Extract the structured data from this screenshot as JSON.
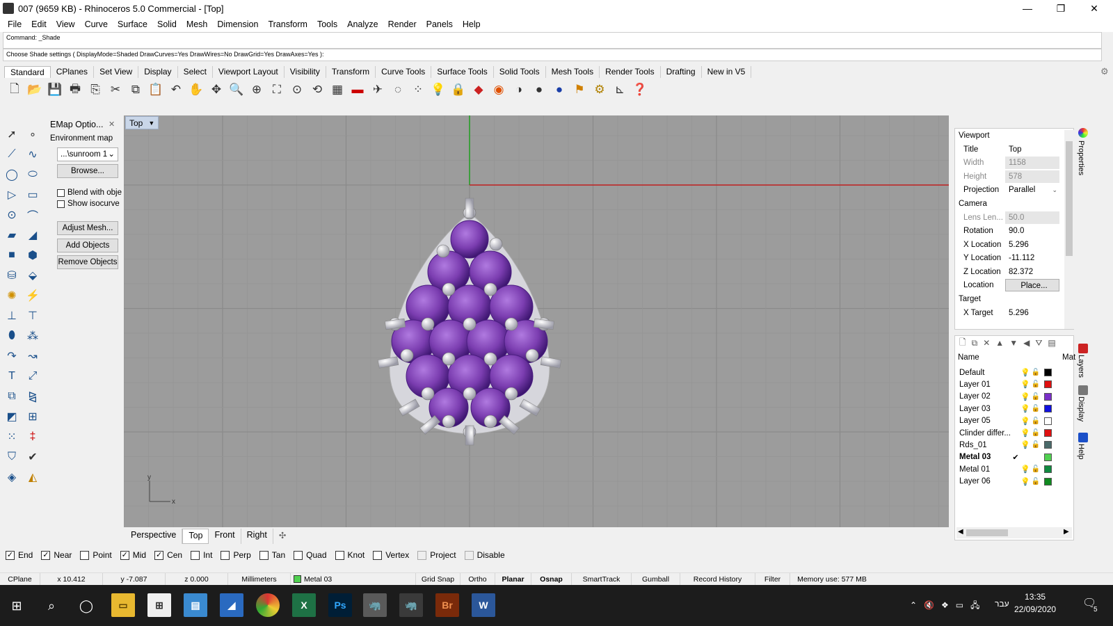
{
  "window": {
    "title": "007 (9659 KB) - Rhinoceros 5.0 Commercial - [Top]"
  },
  "menu": [
    "File",
    "Edit",
    "View",
    "Curve",
    "Surface",
    "Solid",
    "Mesh",
    "Dimension",
    "Transform",
    "Tools",
    "Analyze",
    "Render",
    "Panels",
    "Help"
  ],
  "command": {
    "history": "Command: _Shade",
    "prompt": "Choose Shade settings ( DisplayMode=Shaded  DrawCurves=Yes  DrawWires=No  DrawGrid=Yes  DrawAxes=Yes ):"
  },
  "toolbar_tabs": [
    "Standard",
    "CPlanes",
    "Set View",
    "Display",
    "Select",
    "Viewport Layout",
    "Visibility",
    "Transform",
    "Curve Tools",
    "Surface Tools",
    "Solid Tools",
    "Mesh Tools",
    "Render Tools",
    "Drafting",
    "New in V5"
  ],
  "emap": {
    "title": "EMap Optio...",
    "env_label": "Environment map",
    "env_value": "...\\sunroom 1",
    "browse": "Browse...",
    "blend": "Blend with obje",
    "isocurve": "Show isocurve",
    "adjust": "Adjust Mesh...",
    "add": "Add Objects",
    "remove": "Remove Objects"
  },
  "viewport": {
    "name": "Top",
    "axis_x": "x",
    "axis_y": "y"
  },
  "viewport_tabs": [
    "Perspective",
    "Top",
    "Front",
    "Right"
  ],
  "properties": {
    "section_viewport": "Viewport",
    "title_k": "Title",
    "title_v": "Top",
    "width_k": "Width",
    "width_v": "1158",
    "height_k": "Height",
    "height_v": "578",
    "projection_k": "Projection",
    "projection_v": "Parallel",
    "section_camera": "Camera",
    "lens_k": "Lens Len...",
    "lens_v": "50.0",
    "rotation_k": "Rotation",
    "rotation_v": "90.0",
    "xloc_k": "X Location",
    "xloc_v": "5.296",
    "yloc_k": "Y Location",
    "yloc_v": "-11.112",
    "zloc_k": "Z Location",
    "zloc_v": "82.372",
    "location_k": "Location",
    "location_v": "Place...",
    "section_target": "Target",
    "xtarget_k": "X Target",
    "xtarget_v": "5.296"
  },
  "side_tabs": {
    "properties": "Properties",
    "layers": "Layers",
    "display": "Display",
    "help": "Help"
  },
  "layers": {
    "col_name": "Name",
    "col_mat": "Mat",
    "rows": [
      {
        "name": "Default",
        "color": "#000000"
      },
      {
        "name": "Layer 01",
        "color": "#e01010"
      },
      {
        "name": "Layer 02",
        "color": "#7a2fc8"
      },
      {
        "name": "Layer 03",
        "color": "#1010e0"
      },
      {
        "name": "Layer 05",
        "color": "#ffffff"
      },
      {
        "name": "Clinder differ...",
        "color": "#e01010"
      },
      {
        "name": "Rds_01",
        "color": "#4a6a6a"
      },
      {
        "name": "Metal 03",
        "color": "#50d050",
        "current": "✔"
      },
      {
        "name": "Metal 01",
        "color": "#108a40"
      },
      {
        "name": "Layer 06",
        "color": "#108a20"
      }
    ]
  },
  "osnaps": [
    {
      "label": "End",
      "checked": true
    },
    {
      "label": "Near",
      "checked": true
    },
    {
      "label": "Point",
      "checked": false
    },
    {
      "label": "Mid",
      "checked": true
    },
    {
      "label": "Cen",
      "checked": true
    },
    {
      "label": "Int",
      "checked": false
    },
    {
      "label": "Perp",
      "checked": false
    },
    {
      "label": "Tan",
      "checked": false
    },
    {
      "label": "Quad",
      "checked": false
    },
    {
      "label": "Knot",
      "checked": false
    },
    {
      "label": "Vertex",
      "checked": false
    },
    {
      "label": "Project",
      "checked": false
    },
    {
      "label": "Disable",
      "checked": false
    }
  ],
  "status": {
    "cplane": "CPlane",
    "x": "x 10.412",
    "y": "y -7.087",
    "z": "z 0.000",
    "units": "Millimeters",
    "layer": "Metal 03",
    "grid_snap": "Grid Snap",
    "ortho": "Ortho",
    "planar": "Planar",
    "osnap": "Osnap",
    "smarttrack": "SmartTrack",
    "gumball": "Gumball",
    "record": "Record History",
    "filter": "Filter",
    "memory": "Memory use: 577 MB"
  },
  "taskbar": {
    "time": "13:35",
    "date": "22/09/2020",
    "lang": "עבר",
    "notifications": "5",
    "ps": "Ps",
    "br": "Br",
    "w": "W",
    "x": "X"
  },
  "colors": {
    "gem": "#7b3db0",
    "viewport_bg": "#9c9c9c",
    "red_axis": "#c02020",
    "green_axis": "#20a020"
  }
}
